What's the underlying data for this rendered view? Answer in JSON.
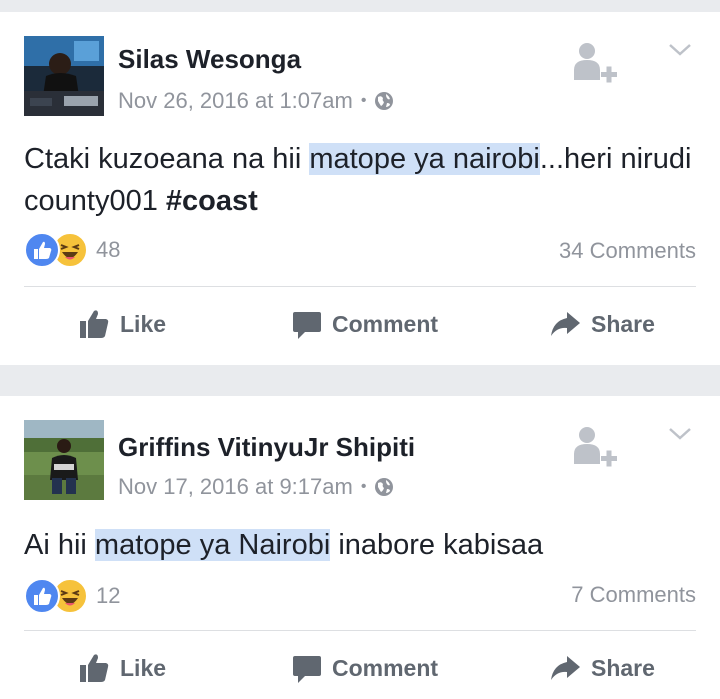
{
  "posts": [
    {
      "author": "Silas Wesonga",
      "timestamp": "Nov 26, 2016 at 1:07am",
      "separator": "•",
      "privacy_icon": "globe-icon",
      "text_before": "Ctaki kuzoeana na hii ",
      "text_highlight": "matope ya nairobi",
      "text_after": "...heri nirudi county001 ",
      "hashtag": "#coast",
      "reaction_count": "48",
      "comments": "34 Comments",
      "actions": {
        "like": "Like",
        "comment": "Comment",
        "share": "Share"
      }
    },
    {
      "author": "Griffins VitinyuJr Shipiti",
      "timestamp": "Nov 17, 2016 at 9:17am",
      "separator": "•",
      "privacy_icon": "globe-icon",
      "text_before": "Ai hii ",
      "text_highlight": "matope ya Nairobi",
      "text_after": " inabore kabisaa",
      "hashtag": "",
      "reaction_count": "12",
      "comments": "7 Comments",
      "actions": {
        "like": "Like",
        "comment": "Comment",
        "share": "Share"
      }
    }
  ],
  "colors": {
    "background": "#e9ebee",
    "card": "#ffffff",
    "highlight": "#cfe0f7",
    "like_blue": "#4f87f0",
    "haha_yellow": "#f6c23b",
    "meta_gray": "#90949c",
    "action_gray": "#606770"
  }
}
